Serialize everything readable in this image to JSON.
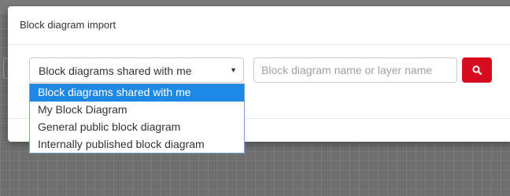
{
  "dialog": {
    "title": "Block diagram import"
  },
  "filter": {
    "selected": "Block diagrams shared with me",
    "options": [
      "Block diagrams shared with me",
      "My Block Diagram",
      "General public block diagram",
      "Internally published block diagram"
    ]
  },
  "search": {
    "placeholder": "Block diagram name or layer name",
    "value": ""
  },
  "colors": {
    "search_button": "#d60d1e",
    "highlight": "#1e88e5"
  },
  "icons": {
    "search_button": "search-icon",
    "dropdown": "chevron-down-icon"
  }
}
